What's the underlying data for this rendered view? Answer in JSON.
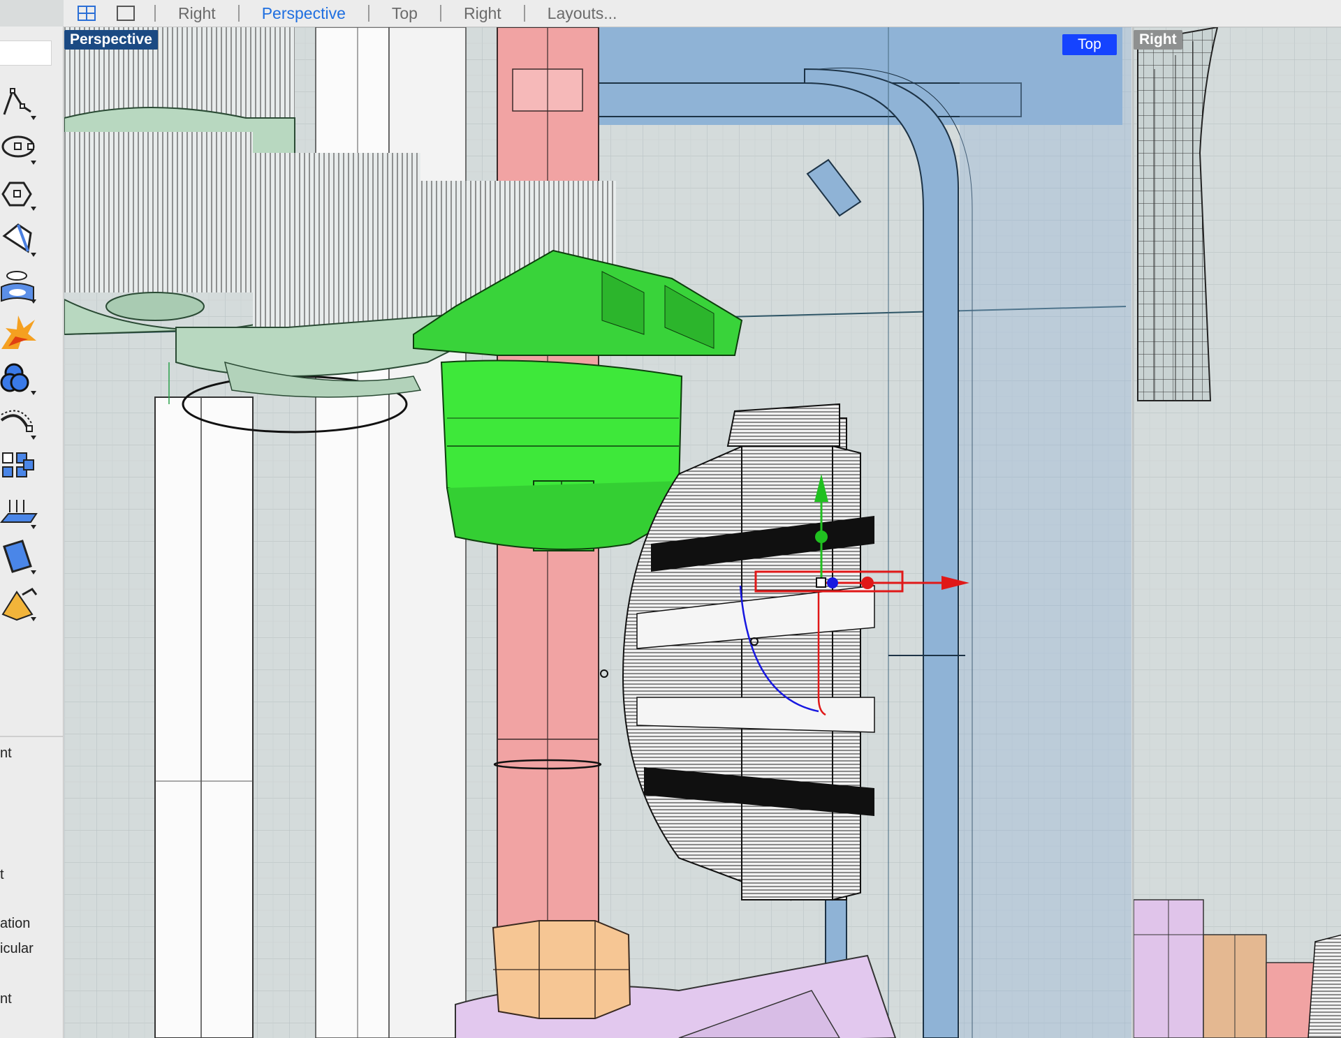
{
  "top_tabs": {
    "layout_buttons": [
      "four-viewports-icon",
      "single-viewport-icon"
    ],
    "tabs": [
      {
        "label": "Right",
        "active": false
      },
      {
        "label": "Perspective",
        "active": true
      },
      {
        "label": "Top",
        "active": false
      },
      {
        "label": "Right",
        "active": false
      },
      {
        "label": "Layouts...",
        "active": false
      }
    ]
  },
  "viewports": {
    "perspective_label": "Perspective",
    "top_label": "Top",
    "right_label": "Right"
  },
  "left_toolbar": {
    "tools": [
      "polyline-icon",
      "circle-icon",
      "polygon-icon",
      "surface-icon",
      "cylinder-icon",
      "explode-icon",
      "boolean-icon",
      "fillet-icon",
      "array-icon",
      "extrude-icon",
      "solid-icon",
      "render-icon"
    ],
    "panel_labels": [
      "nt",
      "t",
      "ation",
      "icular",
      "nt"
    ]
  },
  "colors": {
    "selection_accent": "#1f6fe0",
    "gear_selected": "#3ee83a",
    "shaft": "#f1a3a3",
    "frame": "#8fb3d6",
    "base": "#e2c8ee"
  }
}
